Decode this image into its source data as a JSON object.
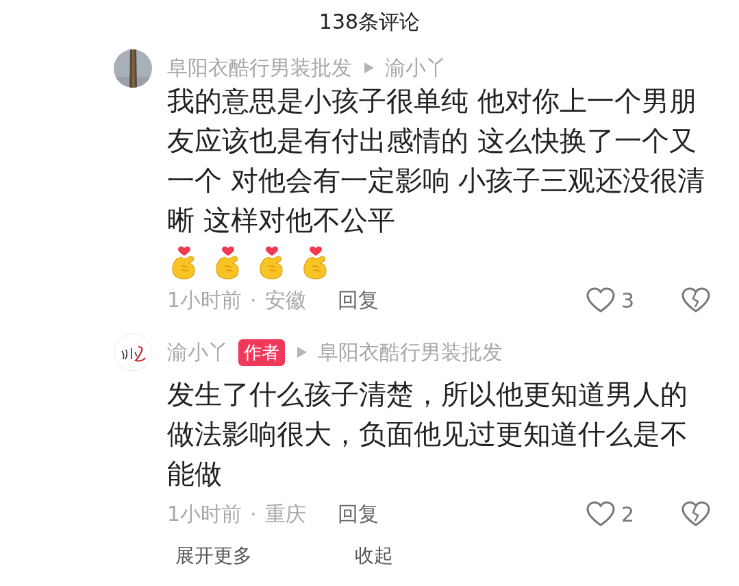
{
  "header": {
    "title": "138条评论"
  },
  "comments": [
    {
      "author": "阜阳衣酷行男装批发",
      "is_author": false,
      "reply_to": "渝小丫",
      "text": "我的意思是小孩子很单纯 他对你上一个男朋友应该也是有付出感情的 这么快换了一个又一个 对他会有一定影响 小孩子三观还没很清晰 这样对他不公平",
      "emojis": [
        {
          "kind": "finger-heart"
        },
        {
          "kind": "finger-heart"
        },
        {
          "kind": "finger-heart"
        },
        {
          "kind": "finger-heart"
        }
      ],
      "time": "1小时前",
      "separator": "·",
      "location": "安徽",
      "reply_label": "回复",
      "likes": "3",
      "liked": false
    },
    {
      "author": "渝小丫",
      "is_author": true,
      "author_badge": "作者",
      "reply_to": "阜阳衣酷行男装批发",
      "avatar": {
        "kind": "logo"
      },
      "text": "发生了什么孩子清楚，所以他更知道男人的做法影响很大，负面他见过更知道什么是不能做",
      "time": "1小时前",
      "separator": "·",
      "location": "重庆",
      "reply_label": "回复",
      "likes": "2",
      "liked": false
    }
  ],
  "footer": {
    "expand": "展开更多",
    "collapse": "收起"
  }
}
